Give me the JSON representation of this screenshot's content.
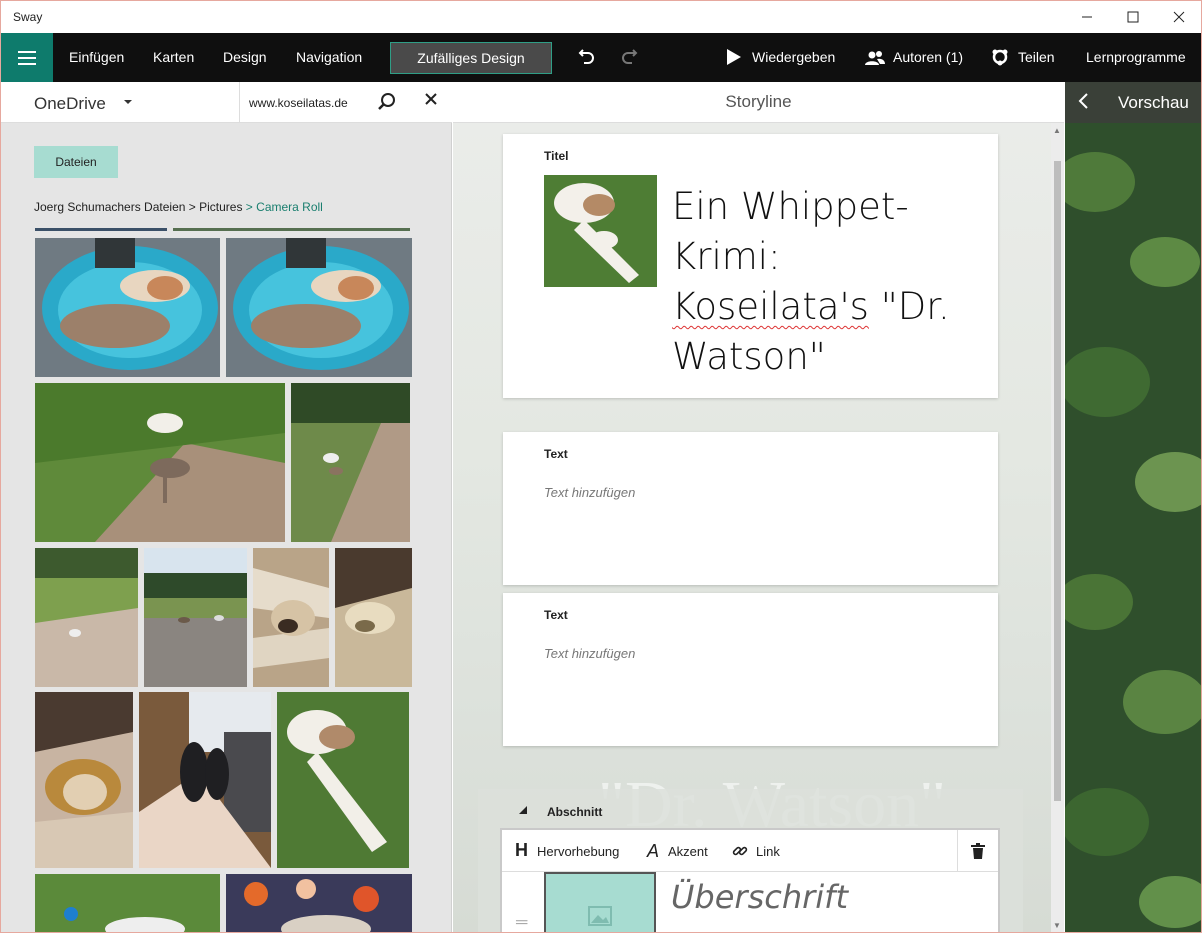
{
  "window": {
    "title": "Sway",
    "minimize": "–",
    "maximize": "☐",
    "close": "✕"
  },
  "commandbar": {
    "insert": "Einfügen",
    "cards": "Karten",
    "design": "Design",
    "navigation": "Navigation",
    "random_design": "Zufälliges Design",
    "play": "Wiedergeben",
    "authors": "Autoren (1)",
    "share": "Teilen",
    "tutorials": "Lernprogramme",
    "accent_color": "#0e7b6c"
  },
  "left_panel": {
    "source": "OneDrive",
    "search_value": "www.koseilatas.de",
    "files_button": "Dateien",
    "breadcrumb": {
      "root": "Joerg Schumachers Dateien",
      "sep1": " > ",
      "folder": "Pictures",
      "sep2": " > ",
      "current": "Camera Roll"
    },
    "photos": [
      "dogs-on-blue-bed-1",
      "dogs-on-blue-bed-2",
      "dogs-on-path-grass",
      "dog-on-forest-path",
      "dog-on-field-path",
      "dogs-on-meadow",
      "dog-in-blanket-1",
      "dog-in-blanket-2",
      "dog-sleeping-blanket",
      "feet-in-socks",
      "dog-lying-grass",
      "dog-in-grass-ball",
      "floral-blanket"
    ]
  },
  "storyline": {
    "header": "Storyline",
    "title_card": {
      "label": "Titel",
      "title_line_1": "Ein Whippet-",
      "title_line_2": "Krimi:",
      "title_word_misspelled": "Koseilata's",
      "title_line_3_rest": " \"Dr.",
      "title_line_4": "Watson\""
    },
    "text_card_1": {
      "label": "Text",
      "placeholder": "Text hinzufügen"
    },
    "text_card_2": {
      "label": "Text",
      "placeholder": "Text hinzufügen"
    },
    "background_watermark": "\"Dr. Watson\"",
    "section": {
      "label": "Abschnitt",
      "tools": {
        "emphasis": "Hervorhebung",
        "accent": "Akzent",
        "link": "Link"
      },
      "heading_placeholder": "Überschrift"
    }
  },
  "preview": {
    "label": "Vorschau"
  }
}
